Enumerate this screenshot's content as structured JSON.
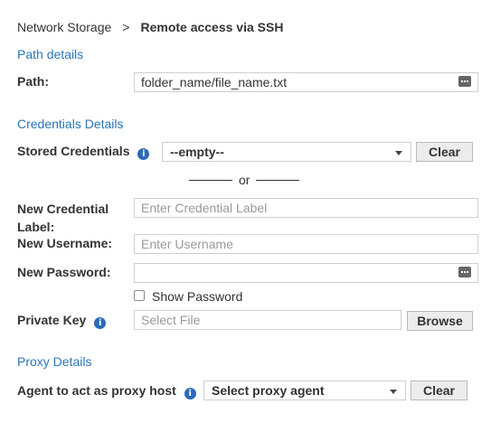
{
  "breadcrumb": {
    "parent": "Network Storage",
    "separator": ">",
    "current": "Remote access via SSH"
  },
  "path_section": {
    "title": "Path details",
    "path_label": "Path:",
    "path_value": "folder_name/file_name.txt"
  },
  "credentials_section": {
    "title": "Credentials Details",
    "stored_label": "Stored Credentials",
    "stored_selected": "--empty--",
    "clear_label": "Clear",
    "or_text": "or",
    "new_label_line1": "New Credential",
    "new_label_line2": "Label:",
    "new_label_placeholder": "Enter Credential Label",
    "username_label": "New Username:",
    "username_placeholder": "Enter Username",
    "password_label": "New Password:",
    "password_value": "",
    "show_password_label": "Show Password",
    "show_password_checked": false,
    "private_key_label": "Private Key",
    "private_key_placeholder": "Select File",
    "browse_label": "Browse"
  },
  "proxy_section": {
    "title": "Proxy Details",
    "agent_label": "Agent to act as proxy host",
    "agent_selected": "Select proxy agent",
    "clear_label": "Clear"
  },
  "colors": {
    "section_title": "#2a75b8",
    "info_icon": "#2a6bb8",
    "button_bg": "#ececec"
  },
  "icons": {
    "password_reveal": "dots-icon",
    "info": "info-icon",
    "dropdown": "chevron-down-icon"
  }
}
